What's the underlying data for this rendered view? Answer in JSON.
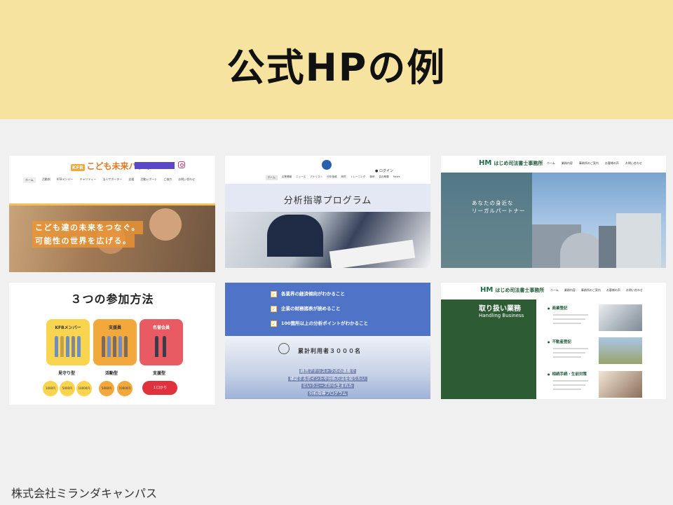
{
  "slide": {
    "title": "公式HPの例",
    "footer": "株式会社ミランダキャンパス"
  },
  "colors": {
    "banner": "#f7e3a0",
    "background": "#f0f0f0",
    "card5_blue": "#4f73c6",
    "card6_green": "#2d5b34"
  },
  "card1": {
    "logo_badge": "KFB",
    "logo": "こども未来バンク",
    "nav": [
      "ホーム",
      "活動例",
      "KFBメンバー",
      "チャリティー",
      "法人サポーター",
      "支援",
      "活動レポート",
      "ご協力",
      "お問い合わせ"
    ],
    "hero_lines": [
      "こども達の未来をつなぐ。",
      "可能性の世界を広げる。"
    ]
  },
  "card2": {
    "login": "ログイン",
    "nav": [
      "ホーム",
      "企業情報",
      "ニュース",
      "アナリスト",
      "分析指導",
      "研究",
      "トレーニング",
      "事例",
      "会社概要",
      "News"
    ],
    "title": "分析指導プログラム"
  },
  "card3": {
    "logo_mark": "HM",
    "logo": "はじめ司法書士事務所",
    "nav": [
      "ホーム",
      "業務内容",
      "事務所のご案内",
      "お客様の声",
      "お問い合わせ"
    ],
    "hero_lines": [
      "あなたの身近な",
      "リーガルパートナー"
    ]
  },
  "card4": {
    "title": "３つの参加方法",
    "plans": [
      {
        "label": "KFBメンバー",
        "tier": "見守り型",
        "amounts": [
          "1000円",
          "5000円",
          "10000円"
        ]
      },
      {
        "label": "支援員",
        "tier": "活動型",
        "amounts": [
          "5000円",
          "10000円"
        ]
      },
      {
        "label": "名誉会員",
        "tier": "支援型",
        "amounts": [
          "１口から"
        ]
      }
    ]
  },
  "card5": {
    "checks": [
      "各業界の経済傾向がわかること",
      "企業の財務諸表が読めること",
      "100箇所以上の分析ポイントがわかること"
    ],
    "count": "累計利用者３０００名",
    "lines": [
      "経営アナリストラボの講義で",
      "確認するポイントや分析方法を知りたい",
      "というニーズから生まれた",
      "分析指導プログラム"
    ]
  },
  "card6": {
    "logo_mark": "HM",
    "logo": "はじめ司法書士事務所",
    "nav": [
      "ホーム",
      "業務内容",
      "事務所のご案内",
      "お客様の声",
      "お問い合わせ"
    ],
    "heading": "取り扱い業務",
    "subheading": "Handling Business",
    "sections": [
      "商業登記",
      "不動産登記",
      "相続手続・生前対策"
    ]
  }
}
